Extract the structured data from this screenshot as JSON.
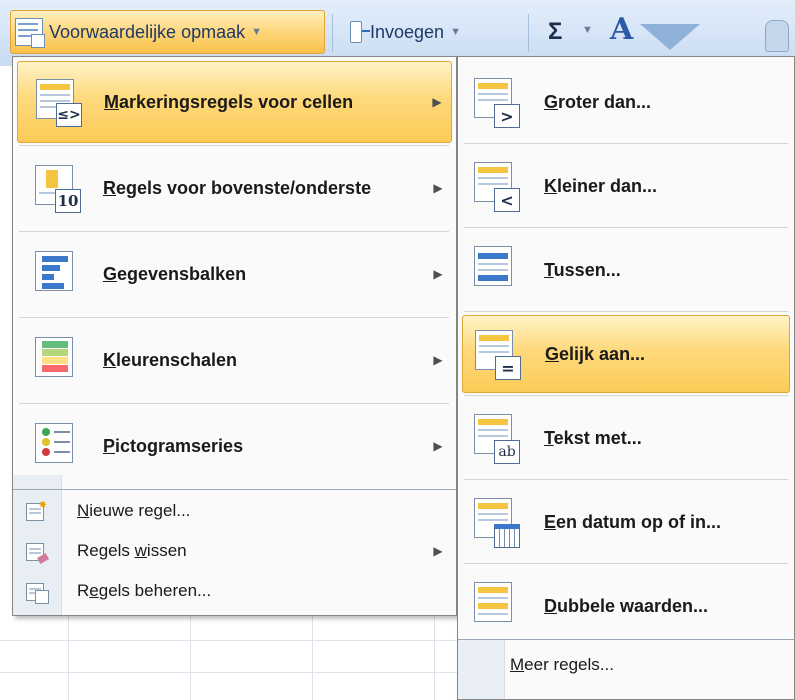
{
  "ribbon": {
    "conditional_formatting": "Voorwaardelijke opmaak",
    "insert": "Invoegen",
    "sigma": "Σ",
    "sort": "A"
  },
  "main_menu": {
    "items": [
      {
        "pre": "",
        "u": "M",
        "post": "arkeringsregels voor cellen",
        "icon": "highlight-cells-rules-icon"
      },
      {
        "pre": "",
        "u": "R",
        "post": "egels voor bovenste/onderste",
        "icon": "top-bottom-rules-icon",
        "badge": "10"
      },
      {
        "pre": "",
        "u": "G",
        "post": "egevensbalken",
        "icon": "data-bars-icon"
      },
      {
        "pre": "",
        "u": "K",
        "post": "leurenschalen",
        "icon": "color-scales-icon"
      },
      {
        "pre": "",
        "u": "P",
        "post": "ictogramseries",
        "icon": "icon-sets-icon"
      }
    ],
    "small_items": [
      {
        "pre": "",
        "u": "N",
        "post": "ieuwe regel...",
        "icon": "new-rule-icon"
      },
      {
        "pre": "Regels ",
        "u": "w",
        "post": "issen",
        "icon": "clear-rules-icon"
      },
      {
        "pre": "R",
        "u": "e",
        "post": "gels beheren...",
        "icon": "manage-rules-icon"
      }
    ]
  },
  "sub_menu": {
    "items": [
      {
        "pre": "",
        "u": "G",
        "post": "roter dan...",
        "badge": ">",
        "icon": "greater-than-icon"
      },
      {
        "pre": "",
        "u": "K",
        "post": "leiner dan...",
        "badge": "<",
        "icon": "less-than-icon"
      },
      {
        "pre": "",
        "u": "T",
        "post": "ussen...",
        "badge": "",
        "icon": "between-icon"
      },
      {
        "pre": "",
        "u": "G",
        "post": "elijk aan...",
        "badge": "=",
        "icon": "equal-to-icon"
      },
      {
        "pre": "",
        "u": "T",
        "post": "ekst met...",
        "badge": "ab",
        "icon": "text-contains-icon"
      },
      {
        "pre": "",
        "u": "E",
        "post": "en datum op of in...",
        "badge": "",
        "icon": "date-occurring-icon"
      },
      {
        "pre": "",
        "u": "D",
        "post": "ubbele waarden...",
        "badge": "",
        "icon": "duplicate-values-icon"
      }
    ],
    "more": {
      "pre": "",
      "u": "M",
      "post": "eer regels..."
    }
  },
  "colors": {
    "highlight_top": "#fff3c7",
    "highlight_bottom": "#fbcb57",
    "highlight_border": "#e1a53c",
    "ribbon": "#d6e5f7"
  }
}
